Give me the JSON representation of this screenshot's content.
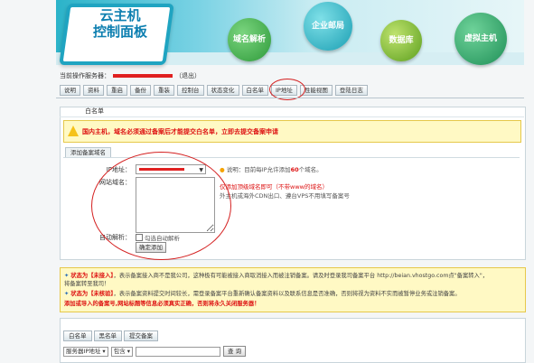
{
  "banner": {
    "logo_text": "云主机\n控制面板",
    "nav": [
      {
        "label": "域名解析"
      },
      {
        "label": "企业邮局"
      },
      {
        "label": "数据库"
      },
      {
        "label": "虚拟主机"
      }
    ]
  },
  "server_info": {
    "label": "当前操作服务器：",
    "exit": "（退出）"
  },
  "tabs": [
    "说明",
    "资料",
    "重启",
    "备份",
    "重装",
    "控制台",
    "状态变化",
    "白名单",
    "IP地址",
    "性能视图",
    "登陆日志"
  ],
  "panel": {
    "title": "白名单",
    "warning": "国内主机，域名必须通过备案后才能提交白名单，立即去提交备案申请",
    "subtab": "添加备案域名",
    "form": {
      "ip_label": "IP地址：",
      "domain_label": "网站域名：",
      "auto_label": "自动解析：",
      "auto_option": "勾选自动解析",
      "submit": "确定添加"
    },
    "tips": {
      "line1_prefix": "说明：目前每IP允许添加",
      "line1_count": "60",
      "line1_suffix": "个域名。",
      "line2": "仅添加顶级域名即可（不带www的域名）",
      "line3": "外主机或海外CDN出口、遵台VPS不用填写备案号"
    }
  },
  "notice": {
    "s1_tag": "状态为【未接入】",
    "s1_text": "，表示备案接入商不是我公司，这种极有可能被接入商取消接入而被注销备案。请及时登录我司备案平台 http://beian.vhostgo.com点\"备案转入\"，",
    "s1_text2": "将备案转至我司！",
    "s2_tag": "状态为【未核验】",
    "s2_text": "，表示备案资料提交时间较长，需登录备案平台重新确认备案资料以及联系信息是否准确，否则将视为资料不实而被暂停业务或注销备案。",
    "footer": "添加或导入的备案号,网站标题等信息必须真实正确，否则将永久关闭服务器！"
  },
  "bottom": {
    "tabs": [
      "白名单",
      "黑名单",
      "提交备案"
    ],
    "search_field": "服务器IP地址",
    "search_mode": "包含",
    "search_button": "查 询"
  },
  "colors": {
    "accent": "#1fa4c1",
    "alert": "#d11111",
    "warn_bg": "#fff9c4"
  }
}
